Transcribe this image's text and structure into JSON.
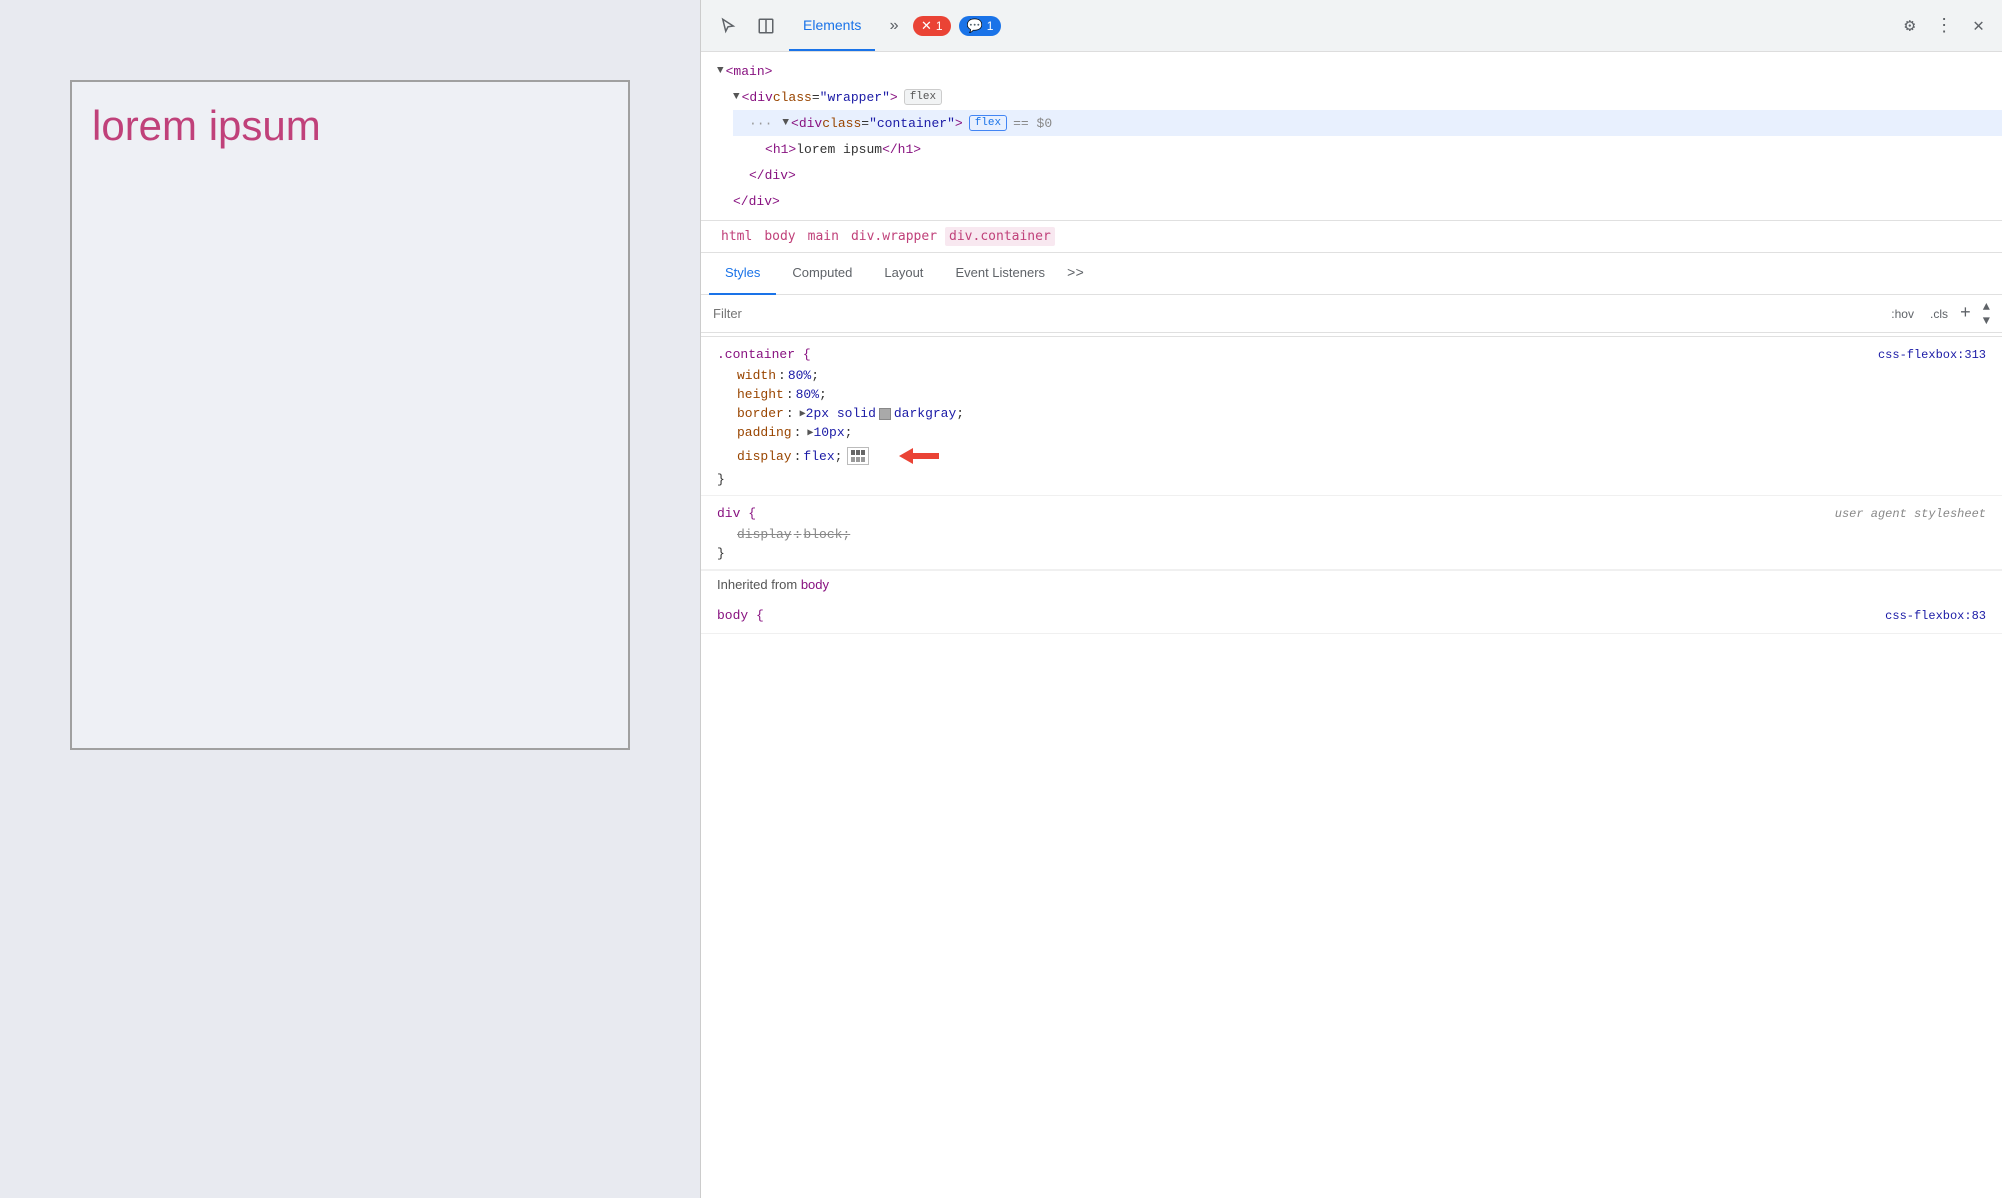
{
  "viewport": {
    "lorem_text": "lorem ipsum"
  },
  "devtools": {
    "tabs": {
      "elements_label": "Elements",
      "more_label": "»"
    },
    "badges": {
      "error_count": "1",
      "info_count": "1"
    },
    "dom_tree": {
      "main_tag": "<main>",
      "wrapper_open": "<div class=\"wrapper\">",
      "wrapper_badge": "flex",
      "container_open": "<div class=\"container\">",
      "container_badge": "flex",
      "container_dollar": "== $0",
      "h1_open": "<h1>lorem ipsum</h1>",
      "div_close1": "</div>",
      "div_close2": "</div>"
    },
    "breadcrumbs": [
      "html",
      "body",
      "main",
      "div.wrapper",
      "div.container"
    ],
    "style_tabs": {
      "styles_label": "Styles",
      "computed_label": "Computed",
      "layout_label": "Layout",
      "event_listeners_label": "Event Listeners",
      "more_label": ">>"
    },
    "filter": {
      "placeholder": "Filter",
      "hov_label": ":hov",
      "cls_label": ".cls",
      "add_label": "+"
    },
    "styles": {
      "container_rule": {
        "selector": ".container {",
        "source": "css-flexbox:313",
        "close_brace": "}",
        "properties": [
          {
            "name": "width",
            "value": "80%",
            "strikethrough": false
          },
          {
            "name": "height",
            "value": "80%",
            "strikethrough": false
          },
          {
            "name": "border",
            "value": "2px solid",
            "extra": "darkgray",
            "has_swatch": true,
            "strikethrough": false
          },
          {
            "name": "padding",
            "value": "10px",
            "has_triangle": true,
            "strikethrough": false
          },
          {
            "name": "display",
            "value": "flex",
            "has_flex_icon": true,
            "has_arrow": true,
            "strikethrough": false
          }
        ]
      },
      "div_rule": {
        "selector": "div {",
        "source": "user agent stylesheet",
        "close_brace": "}",
        "properties": [
          {
            "name": "display",
            "value": "block",
            "strikethrough": true
          }
        ]
      },
      "inherited_label": "Inherited from",
      "inherited_from": "body",
      "body_rule_source": "css-flexbox:83"
    }
  }
}
